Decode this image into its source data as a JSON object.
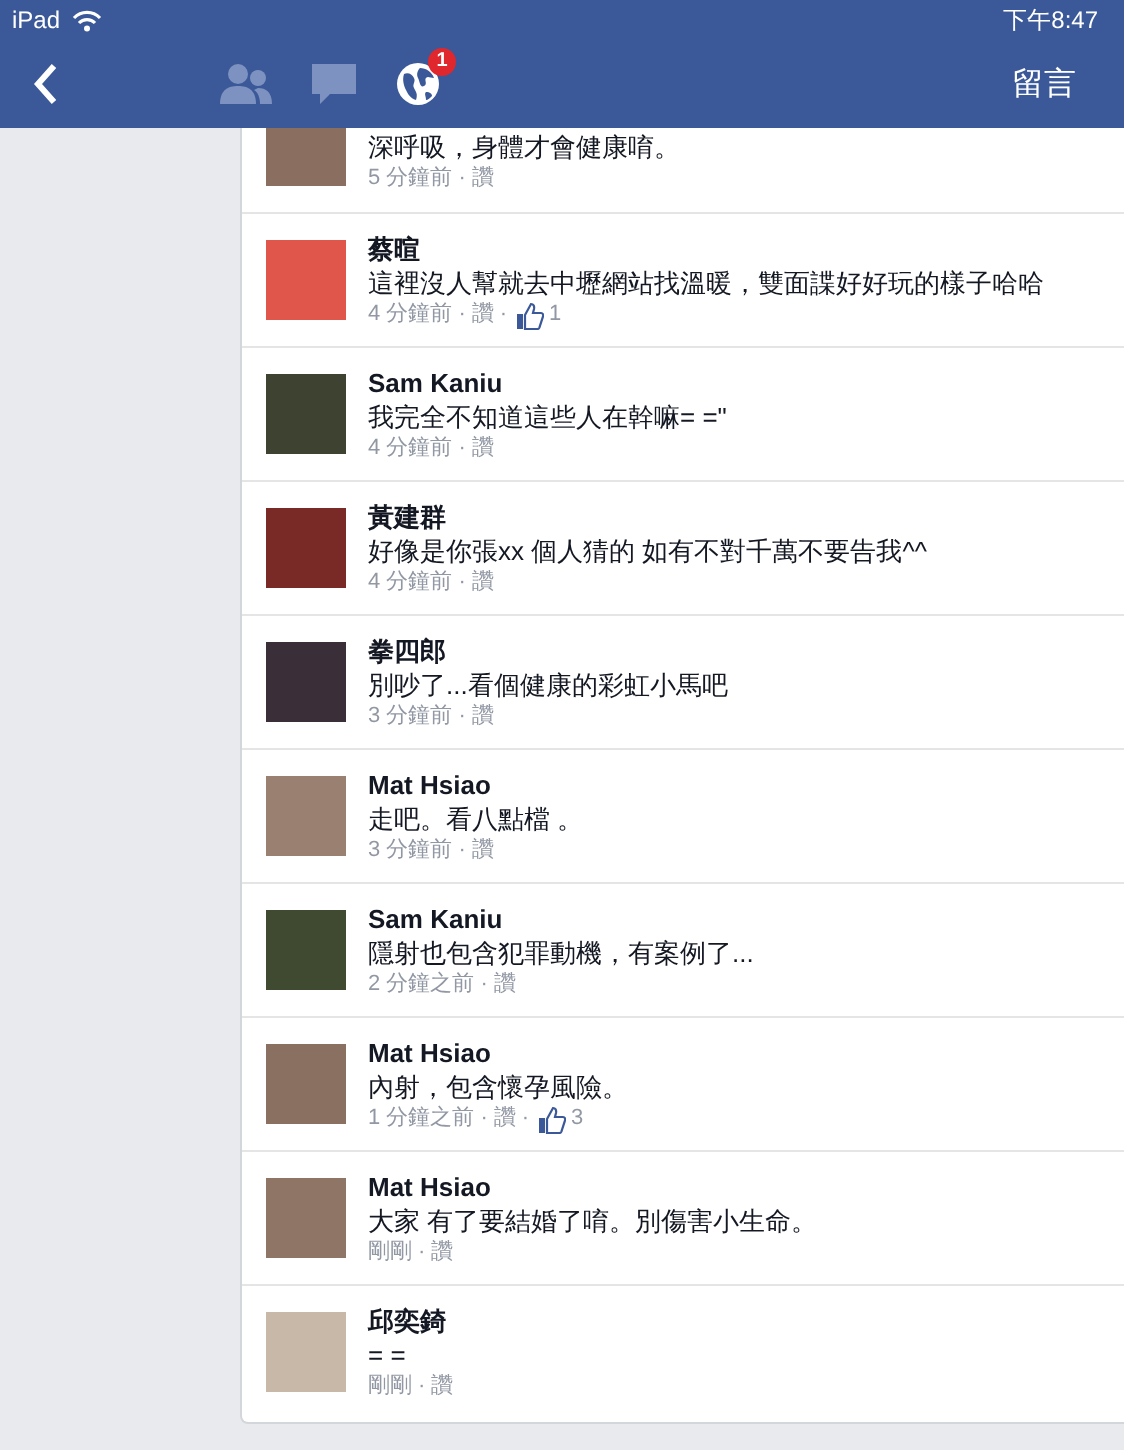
{
  "status_bar": {
    "device": "iPad",
    "time": "下午8:47"
  },
  "nav_bar": {
    "notification_badge": "1",
    "comment_button": "留言"
  },
  "meta_separator": "·",
  "comments": [
    {
      "body": "深呼吸，身體才會健康唷。",
      "time": "5 分鐘前",
      "like_action": "讚"
    },
    {
      "name": "蔡暄",
      "body": "這裡沒人幫就去中壢網站找溫暖，雙面諜好好玩的樣子哈哈",
      "time": "4 分鐘前",
      "like_action": "讚",
      "likes": "1"
    },
    {
      "name": "Sam Kaniu",
      "body": "我完全不知道這些人在幹嘛=  =\"",
      "time": "4 分鐘前",
      "like_action": "讚"
    },
    {
      "name": "黃建群",
      "body": "好像是你張xx 個人猜的 如有不對千萬不要告我^^",
      "time": "4 分鐘前",
      "like_action": "讚"
    },
    {
      "name": "拳四郎",
      "body": "別吵了...看個健康的彩虹小馬吧",
      "time": "3 分鐘前",
      "like_action": "讚"
    },
    {
      "name": "Mat Hsiao",
      "body": "走吧。看八點檔 。",
      "time": "3 分鐘前",
      "like_action": "讚"
    },
    {
      "name": "Sam Kaniu",
      "body": "隱射也包含犯罪動機，有案例了...",
      "time": "2 分鐘之前",
      "like_action": "讚"
    },
    {
      "name": "Mat Hsiao",
      "body": "內射，包含懷孕風險。",
      "time": "1 分鐘之前",
      "like_action": "讚",
      "likes": "3"
    },
    {
      "name": "Mat Hsiao",
      "body": "大家 有了要結婚了唷。別傷害小生命。",
      "time": "剛剛",
      "like_action": "讚"
    },
    {
      "name": "邱奕錡",
      "body": "= =",
      "time": "剛剛",
      "like_action": "讚"
    }
  ]
}
